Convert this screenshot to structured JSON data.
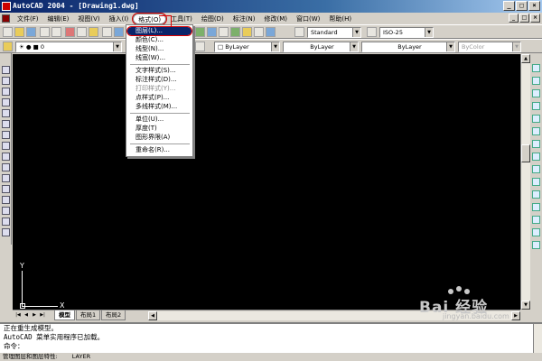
{
  "window": {
    "title": "AutoCAD 2004 - [Drawing1.dwg]",
    "min": "_",
    "max": "□",
    "close": "×"
  },
  "menubar": {
    "items": [
      "文件(F)",
      "编辑(E)",
      "视图(V)",
      "插入(I)",
      "格式(O)",
      "工具(T)",
      "绘图(D)",
      "标注(N)",
      "修改(M)",
      "窗口(W)",
      "帮助(H)"
    ],
    "active_index": 4
  },
  "toolbar": {
    "text_style": "Standard",
    "dim_style": "ISO-25",
    "layer": "0",
    "color": "ByLayer",
    "linetype": "ByLayer",
    "lineweight": "ByLayer",
    "plotstyle": "ByColor"
  },
  "format_menu": {
    "items": [
      {
        "label": "图层(L)...",
        "state": "highlight"
      },
      {
        "label": "颜色(C)...",
        "state": "normal"
      },
      {
        "label": "线型(N)...",
        "state": "normal"
      },
      {
        "label": "线宽(W)...",
        "state": "normal"
      },
      {
        "label": "文字样式(S)...",
        "state": "normal"
      },
      {
        "label": "标注样式(D)...",
        "state": "normal"
      },
      {
        "label": "打印样式(Y)...",
        "state": "disabled"
      },
      {
        "label": "点样式(P)...",
        "state": "normal"
      },
      {
        "label": "多线样式(M)...",
        "state": "normal"
      },
      {
        "label": "单位(U)...",
        "state": "normal"
      },
      {
        "label": "厚度(T)",
        "state": "normal"
      },
      {
        "label": "图形界限(A)",
        "state": "normal"
      },
      {
        "label": "重命名(R)...",
        "state": "normal"
      }
    ]
  },
  "canvas": {
    "background": "#000000",
    "ucs_x": "X",
    "ucs_y": "Y"
  },
  "tabs": [
    "模型",
    "布局1",
    "布局2"
  ],
  "active_tab": 0,
  "command": {
    "lines": [
      "正在重生成模型。",
      "AutoCAD 菜单实用程序已加载。"
    ],
    "prompt": "命令："
  },
  "status": {
    "left": "管理图层和图层特性:",
    "right": "LAYER"
  },
  "watermark": {
    "text": "Bai 经验",
    "sub": "jingyan.baidu.com"
  },
  "colors": {
    "title_start": "#0a246a",
    "highlight": "#0a246a",
    "annotation": "#dd0000",
    "chrome": "#d4d0c8"
  }
}
